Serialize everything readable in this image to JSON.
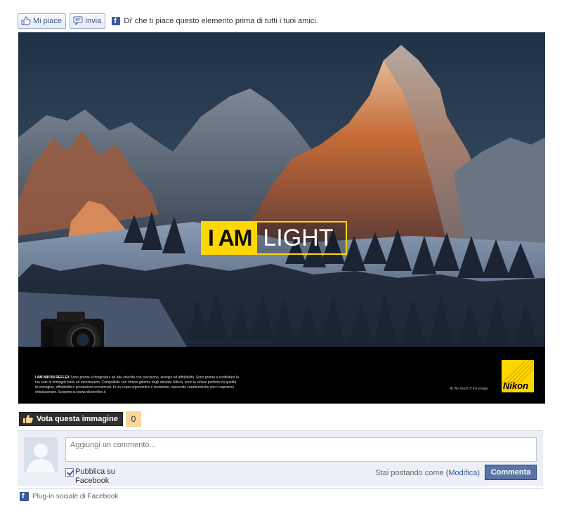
{
  "like_bar": {
    "like_label": "Mi piace",
    "send_label": "Invia",
    "promo_text": "Di' che ti piace questo elemento prima di tutti i tuoi amici."
  },
  "ad": {
    "tag_left": "I AM",
    "tag_right": "LIGHT",
    "copy_heading": "I AM NIKON REFLEX",
    "copy_body": "Sono pronta a fotografare ad alta velocità con precisione, energia ed affidabilità. Sono pronta a soddisfare la tua sete di immagini belle ed emozionanti. Compatibile con l'intera gamma degli obiettivi Nikkor, sono la sintesi perfetta tra qualità di immagine, affidabilità e prestazioni eccezionali. In un corpo ergonomico e resistente, nascondo caratteristiche che ti sapranno entusiasmare. Scoprimi su www.nikonreflex.it",
    "slogan": "At the heart of the image",
    "brand": "Nikon"
  },
  "vote": {
    "label": "Vota questa immagine",
    "count": "0"
  },
  "comment": {
    "placeholder": "Aggiungi un commento...",
    "publish_label": "Pubblica su Facebook",
    "posting_as": "Stai postando come",
    "edit_label": "(Modifica)",
    "submit_label": "Commenta"
  },
  "footer": {
    "plugin_label": "Plug-in sociale di Facebook"
  },
  "colors": {
    "facebook_blue": "#3b5998",
    "nikon_yellow": "#ffd700",
    "vote_count_bg": "#fbd59a"
  }
}
